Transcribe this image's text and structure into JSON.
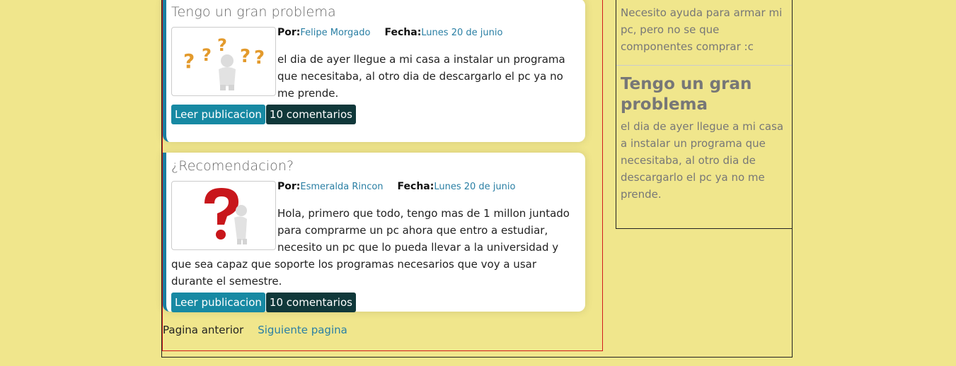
{
  "posts": [
    {
      "title": "Tengo un gran problema",
      "author_label": "Por:",
      "author": "Felipe Morgado",
      "date_label": "Fecha:",
      "date": "Lunes 20 de junio",
      "body": "el dia de ayer llegue a mi casa a instalar un programa que necesitaba, al otro dia de descargarlo el pc ya no me prende.",
      "read_label": "Leer publicacion",
      "comments_label": "10 comentarios",
      "thumb_icon": "question-marks-figure-icon"
    },
    {
      "title": "¿Recomendacion?",
      "author_label": "Por:",
      "author": "Esmeralda Rincon",
      "date_label": "Fecha:",
      "date": "Lunes 20 de junio",
      "body": "Hola, primero que todo, tengo mas de 1 millon juntado para comprarme un pc ahora que entro a estudiar, necesito un pc que lo pueda llevar a la universidad y que sea capaz que soporte los programas necesarios que voy a usar durante el semestre.",
      "read_label": "Leer publicacion",
      "comments_label": "10 comentarios",
      "thumb_icon": "red-question-figure-icon"
    }
  ],
  "pager": {
    "prev_label": "Pagina anterior",
    "next_label": "Siguiente pagina"
  },
  "sidebar": {
    "snippet_top": "Necesito ayuda para armar mi pc, pero no se que componentes comprar :c",
    "item_title": "Tengo un gran problema",
    "item_body": "el dia de ayer llegue a mi casa a instalar un programa que necesitaba, al otro dia de descargarlo el pc ya no me prende."
  },
  "colors": {
    "background": "#f0e68c",
    "accent": "#1789a3",
    "dark_button": "#10383a",
    "link": "#2a7fa4",
    "frame_red": "#d31b1b"
  }
}
